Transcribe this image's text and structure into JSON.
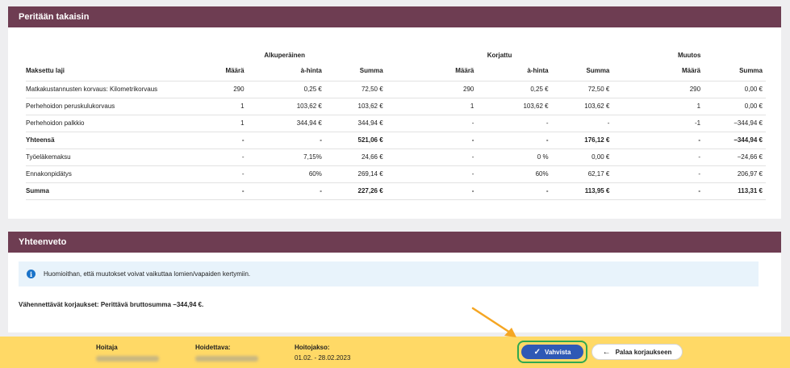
{
  "recover": {
    "title": "Peritään takaisin",
    "groups": {
      "original": "Alkuperäinen",
      "corrected": "Korjattu",
      "change": "Muutos"
    },
    "columns": [
      "Maksettu laji",
      "Määrä",
      "à-hinta",
      "Summa",
      "Määrä",
      "à-hinta",
      "Summa",
      "Määrä",
      "Summa"
    ],
    "rows": [
      {
        "bold": false,
        "cells": [
          "Matkakustannusten korvaus: Kilometrikorvaus",
          "290",
          "0,25 €",
          "72,50 €",
          "290",
          "0,25 €",
          "72,50 €",
          "290",
          "0,00 €"
        ]
      },
      {
        "bold": false,
        "cells": [
          "Perhehoidon peruskulukorvaus",
          "1",
          "103,62 €",
          "103,62 €",
          "1",
          "103,62 €",
          "103,62 €",
          "1",
          "0,00 €"
        ]
      },
      {
        "bold": false,
        "cells": [
          "Perhehoidon palkkio",
          "1",
          "344,94 €",
          "344,94 €",
          "-",
          "-",
          "-",
          "-1",
          "−344,94 €"
        ]
      },
      {
        "bold": true,
        "cells": [
          "Yhteensä",
          "-",
          "-",
          "521,06 €",
          "-",
          "-",
          "176,12 €",
          "-",
          "−344,94 €"
        ]
      },
      {
        "bold": false,
        "cells": [
          "Työeläkemaksu",
          "-",
          "7,15%",
          "24,66 €",
          "-",
          "0 %",
          "0,00 €",
          "-",
          "−24,66 €"
        ]
      },
      {
        "bold": false,
        "cells": [
          "Ennakonpidätys",
          "-",
          "60%",
          "269,14 €",
          "-",
          "60%",
          "62,17 €",
          "-",
          "206,97 €"
        ]
      },
      {
        "bold": true,
        "cells": [
          "Summa",
          "-",
          "-",
          "227,26 €",
          "-",
          "-",
          "113,95 €",
          "-",
          "113,31 €"
        ]
      }
    ]
  },
  "summary_panel": {
    "title": "Yhteenveto",
    "info_text": "Huomioithan, että muutokset voivat vaikuttaa lomien/vapaiden kertymiin.",
    "info_icon": "info-icon",
    "summary_text": "Vähennettävät korjaukset: Perittävä bruttosumma −344,94 €."
  },
  "footer": {
    "caregiver_label": "Hoitaja",
    "care_recipient_label": "Hoidettava:",
    "period_label": "Hoitojakso:",
    "period_value": "01.02. - 28.02.2023",
    "confirm_label": "Vahvista",
    "back_label": "Palaa korjaukseen"
  },
  "colors": {
    "header": "#6e3d52",
    "footer": "#ffd966",
    "confirm_button": "#2f59b5",
    "highlight": "#2fa84f",
    "arrow": "#f5a623"
  }
}
